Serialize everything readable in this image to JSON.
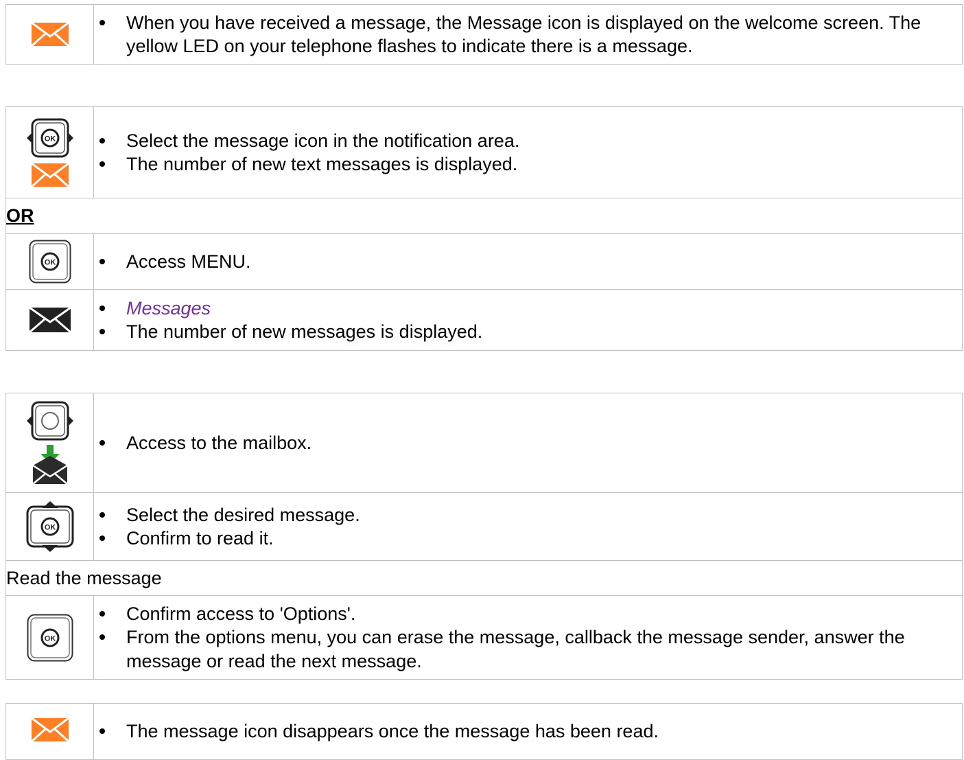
{
  "table1": {
    "rows": [
      {
        "icons": [
          "envelope-orange-icon"
        ],
        "bullets": [
          "When you have received a message, the Message icon is displayed on the welcome screen. The yellow LED on your telephone flashes to indicate there is a message."
        ]
      }
    ]
  },
  "table2": {
    "row1": {
      "icons": [
        "ok-navigator-left-right-icon",
        "envelope-orange-icon"
      ],
      "bullets": [
        "Select the message icon in the notification area.",
        "The number of new text messages is displayed."
      ]
    },
    "or_label": "OR",
    "row2": {
      "icons": [
        "ok-key-icon"
      ],
      "bullets": [
        "Access MENU."
      ]
    },
    "row3": {
      "icons": [
        "envelope-black-icon"
      ],
      "bullets": [
        "Messages",
        "The number of new messages is displayed."
      ]
    }
  },
  "table3": {
    "row1": {
      "icons": [
        "navigator-left-right-icon",
        "mailbox-download-icon"
      ],
      "bullets": [
        "Access to the mailbox."
      ]
    },
    "row2": {
      "icons": [
        "ok-navigator-up-down-icon"
      ],
      "bullets": [
        "Select the desired message.",
        "Confirm to read it."
      ]
    },
    "section_label": "Read the message",
    "row3": {
      "icons": [
        "ok-key-icon"
      ],
      "bullets": [
        "Confirm access to 'Options'.",
        "From the options menu, you can erase the message, callback the message sender, answer the message or read the next message."
      ]
    }
  },
  "table4": {
    "row1": {
      "icons": [
        "envelope-orange-icon"
      ],
      "bullets": [
        "The message icon disappears once the message has been read."
      ]
    }
  },
  "colors": {
    "envelope_orange": "#ff7f27",
    "italic_link": "#7030a0",
    "border": "#bfbfbf",
    "download_arrow": "#2e9e2e"
  }
}
